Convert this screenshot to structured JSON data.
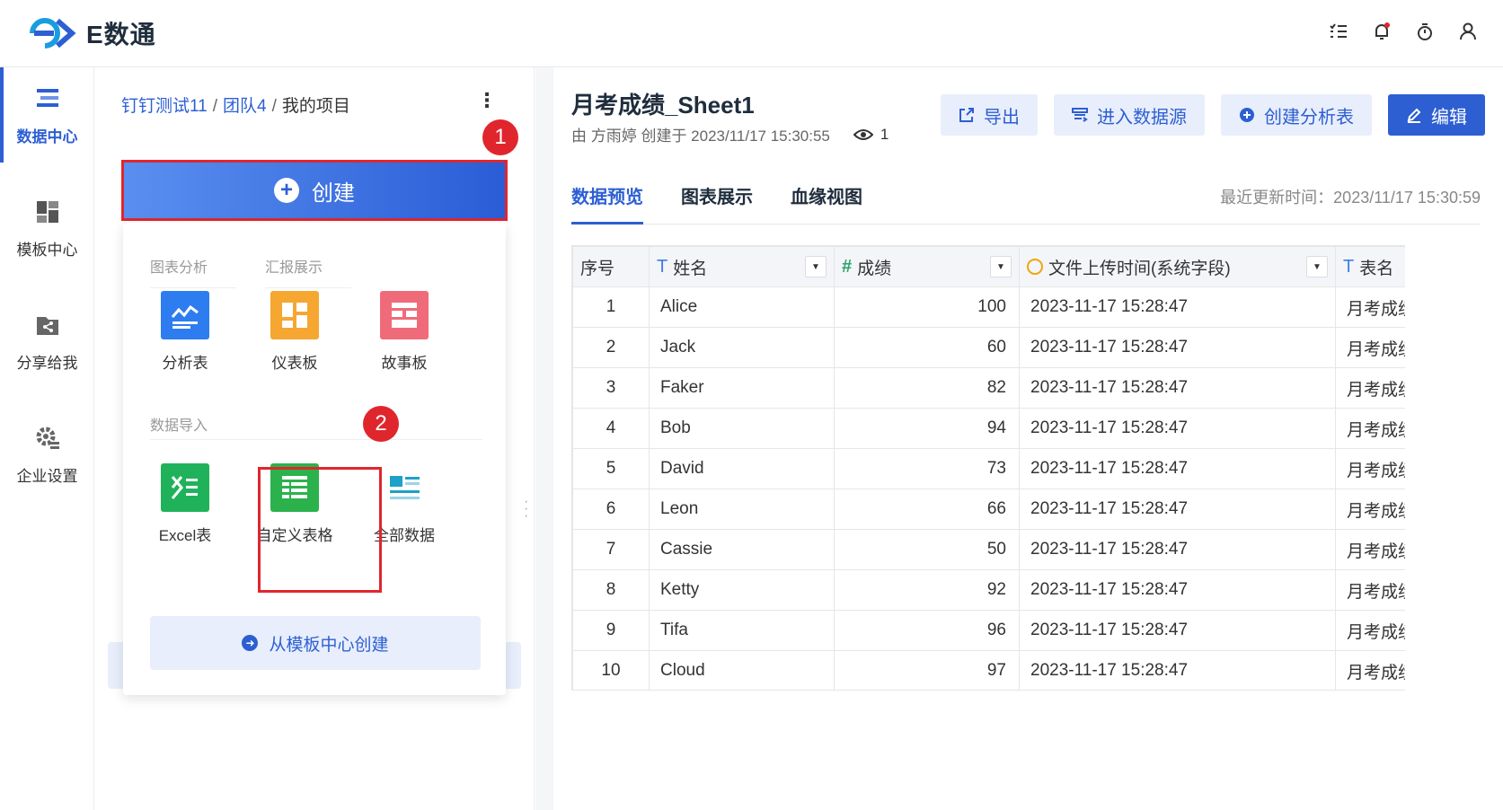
{
  "app": {
    "name": "E数通"
  },
  "rail": [
    {
      "label": "数据中心",
      "icon": "data-center-icon",
      "active": true
    },
    {
      "label": "模板中心",
      "icon": "template-center-icon",
      "active": false
    },
    {
      "label": "分享给我",
      "icon": "share-icon",
      "active": false
    },
    {
      "label": "企业设置",
      "icon": "settings-icon",
      "active": false
    }
  ],
  "breadcrumb": {
    "part1": "钉钉测试11",
    "part2": "团队4",
    "part3": "我的项目",
    "sep": "/"
  },
  "create": {
    "label": "创建",
    "tabs": [
      "图表分析",
      "汇报展示"
    ],
    "tiles_top": [
      "分析表",
      "仪表板",
      "故事板"
    ],
    "import_title": "数据导入",
    "tiles_bottom": [
      "Excel表",
      "自定义表格",
      "全部数据"
    ],
    "template_button": "从模板中心创建"
  },
  "badges": [
    "1",
    "2"
  ],
  "sheet": {
    "title": "月考成绩_Sheet1",
    "meta": "由 方雨婷 创建于 2023/11/17 15:30:55",
    "views": "1"
  },
  "actions": [
    "导出",
    "进入数据源",
    "创建分析表",
    "编辑"
  ],
  "tabs": [
    "数据预览",
    "图表展示",
    "血缘视图"
  ],
  "updated": "最近更新时间：2023/11/17 15:30:59",
  "table": {
    "headers": [
      "序号",
      "姓名",
      "成绩",
      "文件上传时间(系统字段)",
      "表名"
    ],
    "rows": [
      [
        "1",
        "Alice",
        "100",
        "2023-11-17 15:28:47",
        "月考成绩"
      ],
      [
        "2",
        "Jack",
        "60",
        "2023-11-17 15:28:47",
        "月考成绩"
      ],
      [
        "3",
        "Faker",
        "82",
        "2023-11-17 15:28:47",
        "月考成绩"
      ],
      [
        "4",
        "Bob",
        "94",
        "2023-11-17 15:28:47",
        "月考成绩"
      ],
      [
        "5",
        "David",
        "73",
        "2023-11-17 15:28:47",
        "月考成绩"
      ],
      [
        "6",
        "Leon",
        "66",
        "2023-11-17 15:28:47",
        "月考成绩"
      ],
      [
        "7",
        "Cassie",
        "50",
        "2023-11-17 15:28:47",
        "月考成绩"
      ],
      [
        "8",
        "Ketty",
        "92",
        "2023-11-17 15:28:47",
        "月考成绩"
      ],
      [
        "9",
        "Tifa",
        "96",
        "2023-11-17 15:28:47",
        "月考成绩"
      ],
      [
        "10",
        "Cloud",
        "97",
        "2023-11-17 15:28:47",
        "月考成绩"
      ]
    ]
  },
  "colors": {
    "accent": "#2d5fd3",
    "highlight": "#e0262d"
  }
}
